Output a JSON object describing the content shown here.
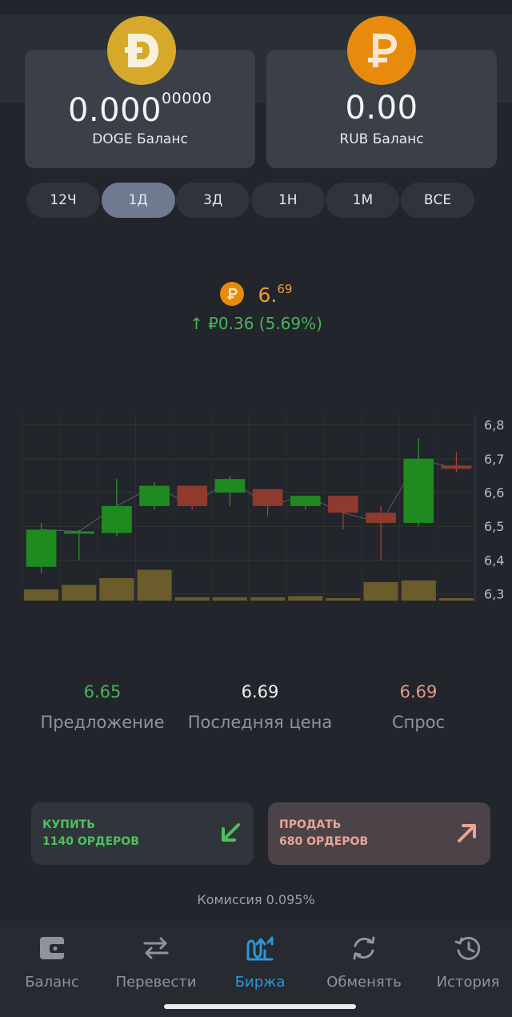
{
  "balances": {
    "doge": {
      "amount_main": "0.000",
      "amount_small": "00000",
      "label": "DOGE Баланс",
      "icon": "doge-coin-icon",
      "color": "#d7a92a"
    },
    "rub": {
      "amount_main": "0.00",
      "amount_small": "",
      "label": "RUB Баланс",
      "icon": "ruble-coin-icon",
      "color": "#e88a0c"
    }
  },
  "periods": [
    {
      "label": "12Ч",
      "active": false
    },
    {
      "label": "1Д",
      "active": true
    },
    {
      "label": "3Д",
      "active": false
    },
    {
      "label": "1Н",
      "active": false
    },
    {
      "label": "1М",
      "active": false
    },
    {
      "label": "ВСЕ",
      "active": false
    }
  ],
  "price": {
    "main": "6.",
    "small": "69",
    "change": "↑ ₽0.36  (5.69%)",
    "icon": "ruble-coin-icon"
  },
  "chart_data": {
    "type": "candlestick",
    "y_ticks": [
      "6,8",
      "6,7",
      "6,6",
      "6,5",
      "6,4",
      "6,3"
    ],
    "ylim": [
      6.28,
      6.83
    ],
    "up_color": "#1f8a1f",
    "down_color": "#8e3a2e",
    "volume_color": "#6b5c2c",
    "candles": [
      {
        "open": 6.38,
        "close": 6.49,
        "high": 6.51,
        "low": 6.36
      },
      {
        "open": 6.48,
        "close": 6.485,
        "high": 6.49,
        "low": 6.4
      },
      {
        "open": 6.48,
        "close": 6.56,
        "high": 6.64,
        "low": 6.47
      },
      {
        "open": 6.56,
        "close": 6.62,
        "high": 6.63,
        "low": 6.55
      },
      {
        "open": 6.62,
        "close": 6.56,
        "high": 6.62,
        "low": 6.55
      },
      {
        "open": 6.6,
        "close": 6.64,
        "high": 6.65,
        "low": 6.56
      },
      {
        "open": 6.61,
        "close": 6.56,
        "high": 6.61,
        "low": 6.53
      },
      {
        "open": 6.56,
        "close": 6.59,
        "high": 6.59,
        "low": 6.55
      },
      {
        "open": 6.59,
        "close": 6.54,
        "high": 6.59,
        "low": 6.49
      },
      {
        "open": 6.54,
        "close": 6.51,
        "high": 6.56,
        "low": 6.4
      },
      {
        "open": 6.51,
        "close": 6.7,
        "high": 6.76,
        "low": 6.5
      },
      {
        "open": 6.68,
        "close": 6.67,
        "high": 6.72,
        "low": 6.66
      }
    ],
    "volume": [
      0.2,
      0.28,
      0.4,
      0.55,
      0.06,
      0.06,
      0.06,
      0.08,
      0.03,
      0.33,
      0.36,
      0.03
    ]
  },
  "stats": [
    {
      "value": "6.65",
      "label": "Предложение",
      "color": "#4ab35a"
    },
    {
      "value": "6.69",
      "label": "Последняя цена",
      "color": "#f0f1f3"
    },
    {
      "value": "6.69",
      "label": "Спрос",
      "color": "#e39a8a"
    }
  ],
  "actions": {
    "buy": {
      "line1": "КУПИТЬ",
      "line2": "1140 ОРДЕРОВ",
      "icon": "arrow-down-left-icon"
    },
    "sell": {
      "line1": "ПРОДАТЬ",
      "line2": "680 ОРДЕРОВ",
      "icon": "arrow-up-right-icon"
    }
  },
  "commission": "Комиссия 0.095%",
  "tabs": [
    {
      "label": "Баланс",
      "icon": "wallet-icon",
      "active": false
    },
    {
      "label": "Перевести",
      "icon": "transfer-arrows-icon",
      "active": false
    },
    {
      "label": "Биржа",
      "icon": "exchange-chart-icon",
      "active": true
    },
    {
      "label": "Обменять",
      "icon": "refresh-icon",
      "active": false
    },
    {
      "label": "История",
      "icon": "history-clock-icon",
      "active": false
    }
  ]
}
